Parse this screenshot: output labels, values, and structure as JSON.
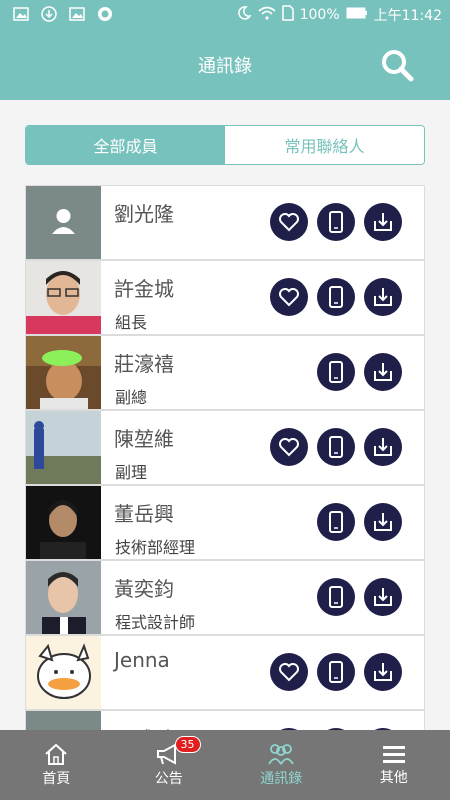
{
  "status_bar": {
    "battery": "100%",
    "time": "上午11:42"
  },
  "header": {
    "title": "通訊錄"
  },
  "tabs": [
    {
      "label": "全部成員",
      "active": true
    },
    {
      "label": "常用聯絡人",
      "active": false
    }
  ],
  "contacts": [
    {
      "name": "劉光隆",
      "role": "",
      "favorite": true
    },
    {
      "name": "許金城",
      "role": "組長",
      "favorite": true
    },
    {
      "name": "莊濠禧",
      "role": "副總",
      "favorite": false
    },
    {
      "name": "陳堃維",
      "role": "副理",
      "favorite": true
    },
    {
      "name": "董岳興",
      "role": "技術部經理",
      "favorite": false
    },
    {
      "name": "黃奕鈞",
      "role": "程式設計師",
      "favorite": false
    },
    {
      "name": "Jenna",
      "role": "",
      "favorite": true
    },
    {
      "name": "張雅勛",
      "role": "",
      "favorite": true
    }
  ],
  "bottom_nav": [
    {
      "label": "首頁",
      "icon": "home-icon"
    },
    {
      "label": "公告",
      "icon": "megaphone-icon",
      "badge": "35"
    },
    {
      "label": "通訊錄",
      "icon": "contacts-icon",
      "active": true
    },
    {
      "label": "其他",
      "icon": "menu-icon"
    }
  ],
  "colors": {
    "accent": "#78c2bd",
    "action": "#1f1f4a",
    "nav_bg": "#767676"
  }
}
